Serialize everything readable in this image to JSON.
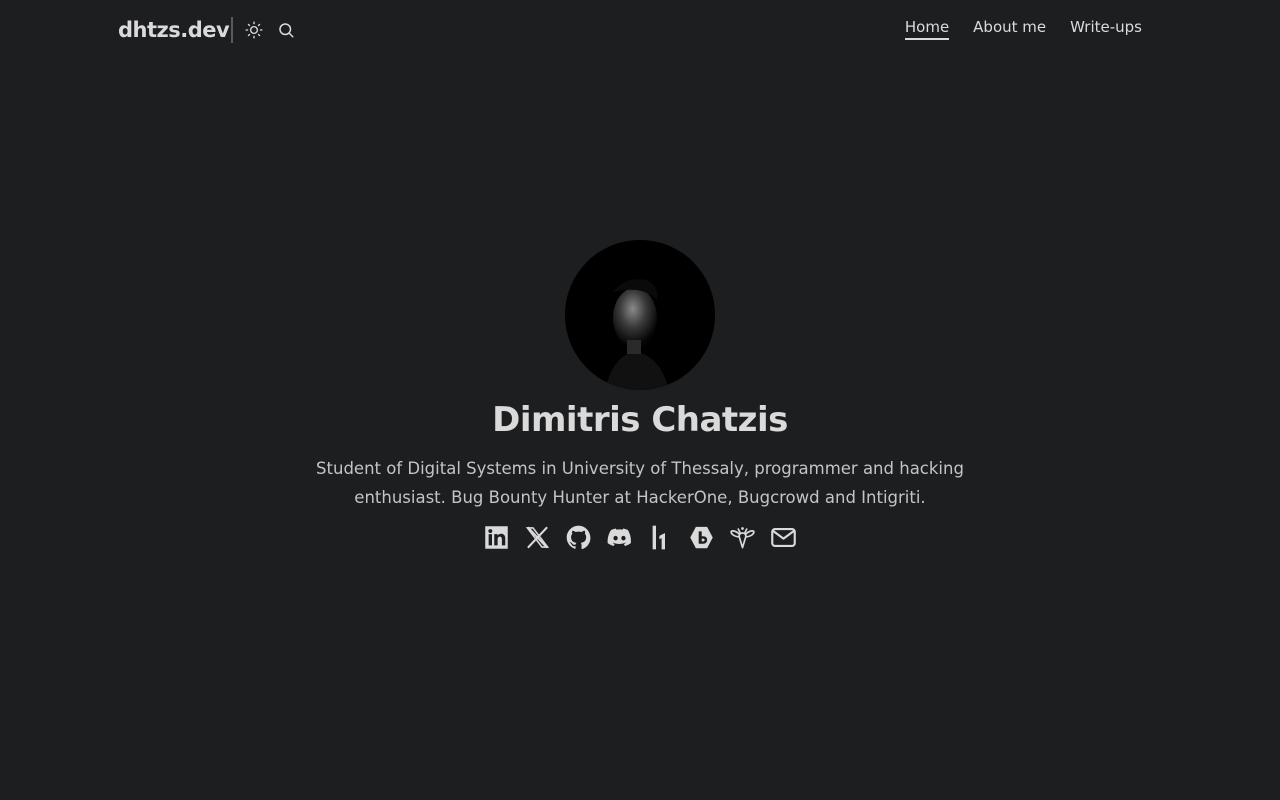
{
  "header": {
    "logo": "dhtzs.dev",
    "nav": [
      {
        "label": "Home",
        "active": true
      },
      {
        "label": "About me",
        "active": false
      },
      {
        "label": "Write-ups",
        "active": false
      }
    ]
  },
  "profile": {
    "name": "Dimitris Chatzis",
    "bio": "Student of Digital Systems in University of Thessaly, programmer and hacking enthusiast. Bug Bounty Hunter at HackerOne, Bugcrowd and Intigriti."
  },
  "social_icons": [
    "linkedin-icon",
    "x-icon",
    "github-icon",
    "discord-icon",
    "hackerone-icon",
    "bugcrowd-icon",
    "intigriti-icon",
    "email-icon"
  ],
  "colors": {
    "background": "#1d1e20",
    "text": "#dadadb",
    "secondary_text": "#c4c4c5"
  }
}
